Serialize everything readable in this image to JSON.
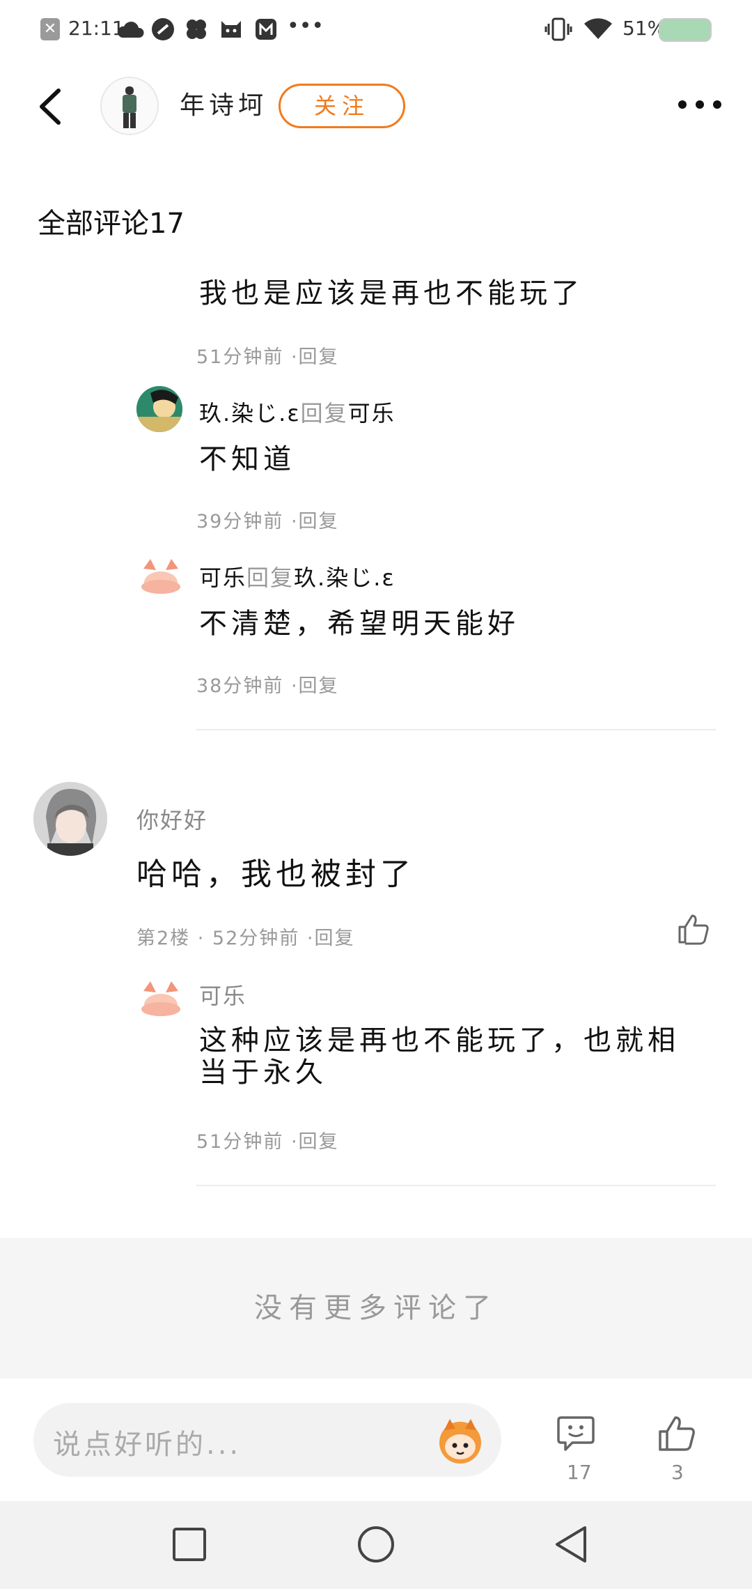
{
  "status_bar": {
    "time": "21:11",
    "battery": "51%"
  },
  "header": {
    "author_name": "年诗坷",
    "follow_label": "关注"
  },
  "comments_title": "全部评论17",
  "thread1": {
    "reply0": {
      "text": "我也是应该是再也不能玩了",
      "meta": "51分钟前 ·回复"
    },
    "reply1": {
      "from": "玖.染じ.ε",
      "action": "回复",
      "to": "可乐",
      "text": "不知道",
      "meta": "39分钟前 ·回复"
    },
    "reply2": {
      "from": "可乐",
      "action": "回复",
      "to": "玖.染じ.ε",
      "text": "不清楚，希望明天能好",
      "meta": "38分钟前 ·回复"
    }
  },
  "thread2": {
    "author": "你好好",
    "text": "哈哈，我也被封了",
    "meta": "第2楼 · 52分钟前 ·回复",
    "reply": {
      "author": "可乐",
      "text": "这种应该是再也不能玩了，也就相当于永久",
      "meta": "51分钟前 ·回复"
    }
  },
  "no_more_text": "没有更多评论了",
  "bottom_bar": {
    "input_placeholder": "说点好听的...",
    "comment_count": "17",
    "like_count": "3"
  },
  "colors": {
    "accent": "#f07a1d",
    "meta_grey": "#999999",
    "divider": "#ececec"
  },
  "icons": [
    "back-arrow-icon",
    "more-icon",
    "like-icon",
    "comment-icon",
    "emoji-icon",
    "nav-square-icon",
    "nav-circle-icon",
    "nav-back-icon"
  ]
}
